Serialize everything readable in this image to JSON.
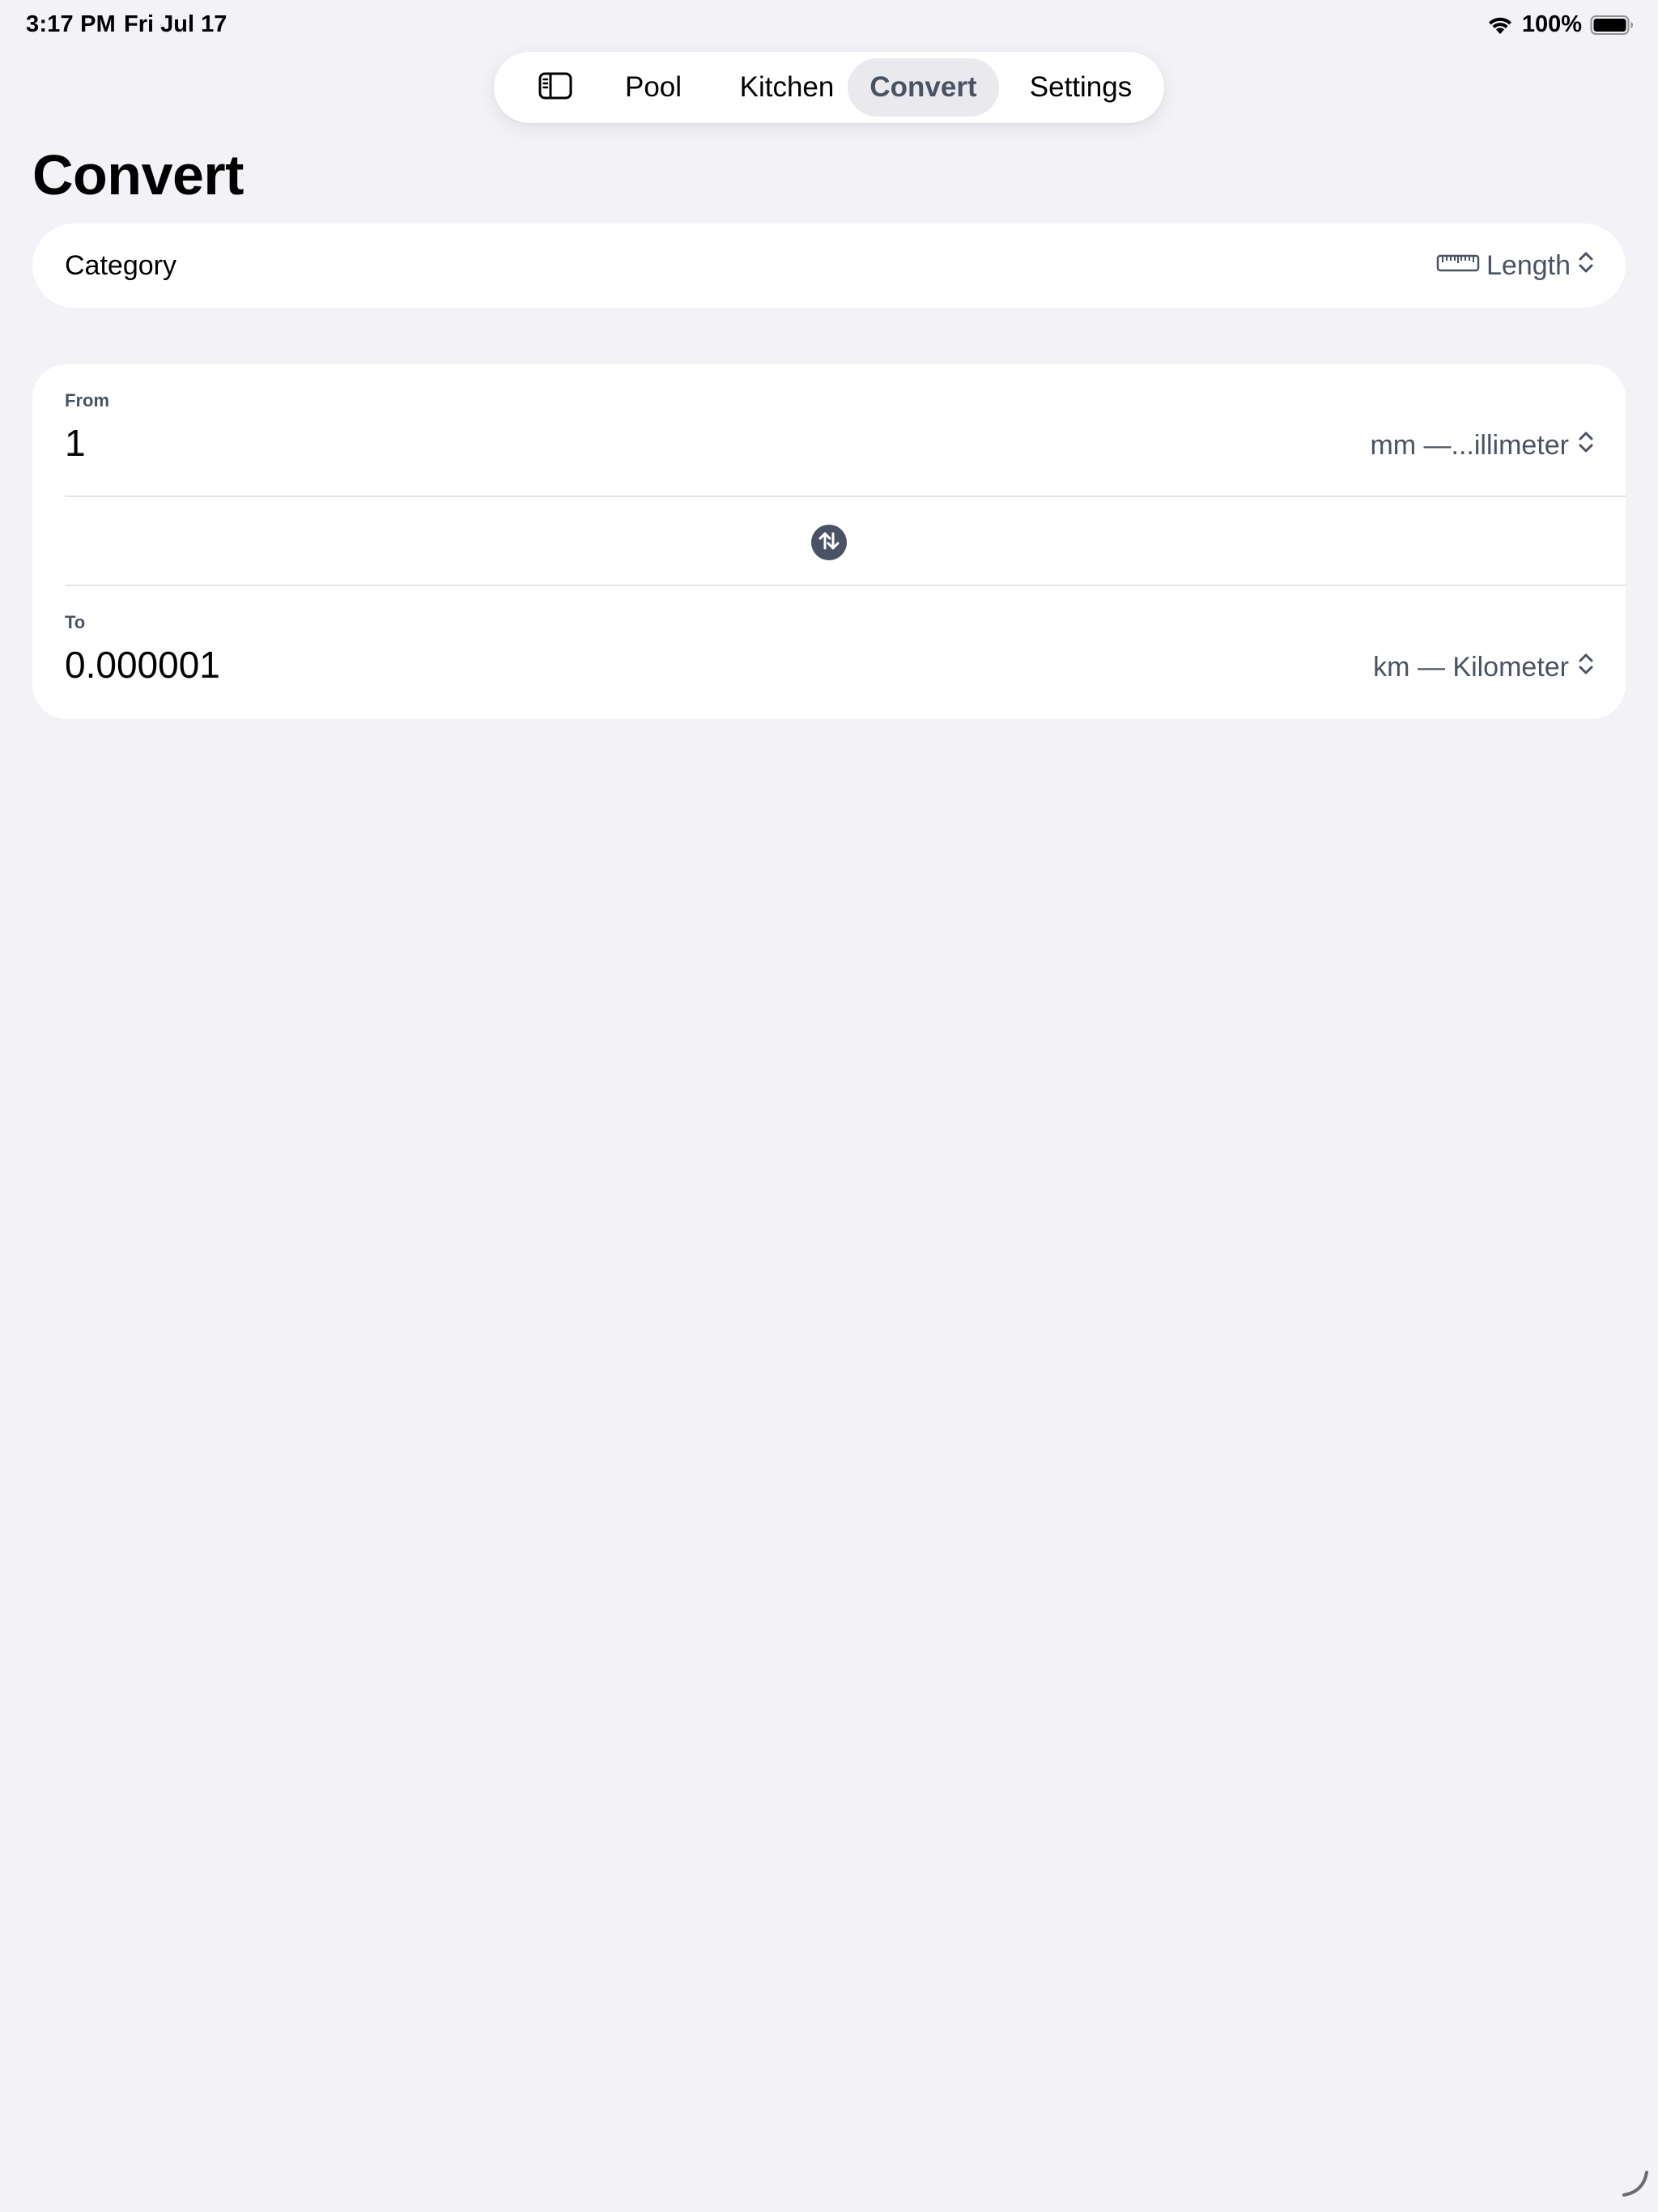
{
  "status_bar": {
    "time": "3:17 PM",
    "date": "Fri Jul 17",
    "battery_percent": "100%",
    "wifi_icon": "wifi-icon",
    "battery_icon": "battery-full-icon"
  },
  "tab_bar": {
    "sidebar_icon": "sidebar-toggle-icon",
    "tabs": [
      {
        "label": "Pool",
        "active": false
      },
      {
        "label": "Kitchen",
        "active": false
      },
      {
        "label": "Convert",
        "active": true
      },
      {
        "label": "Settings",
        "active": false
      }
    ]
  },
  "page": {
    "title": "Convert"
  },
  "category": {
    "label": "Category",
    "icon": "ruler-icon",
    "value": "Length"
  },
  "converter": {
    "from": {
      "label": "From",
      "value": "1",
      "unit": "mm —...illimeter"
    },
    "to": {
      "label": "To",
      "value": "0.000001",
      "unit": "km — Kilometer"
    },
    "swap_icon": "swap-arrows-icon"
  },
  "colors": {
    "background": "#f2f2f7",
    "card": "#ffffff",
    "accent": "#4a5363",
    "active_tab_bg": "#e9e9ee"
  }
}
